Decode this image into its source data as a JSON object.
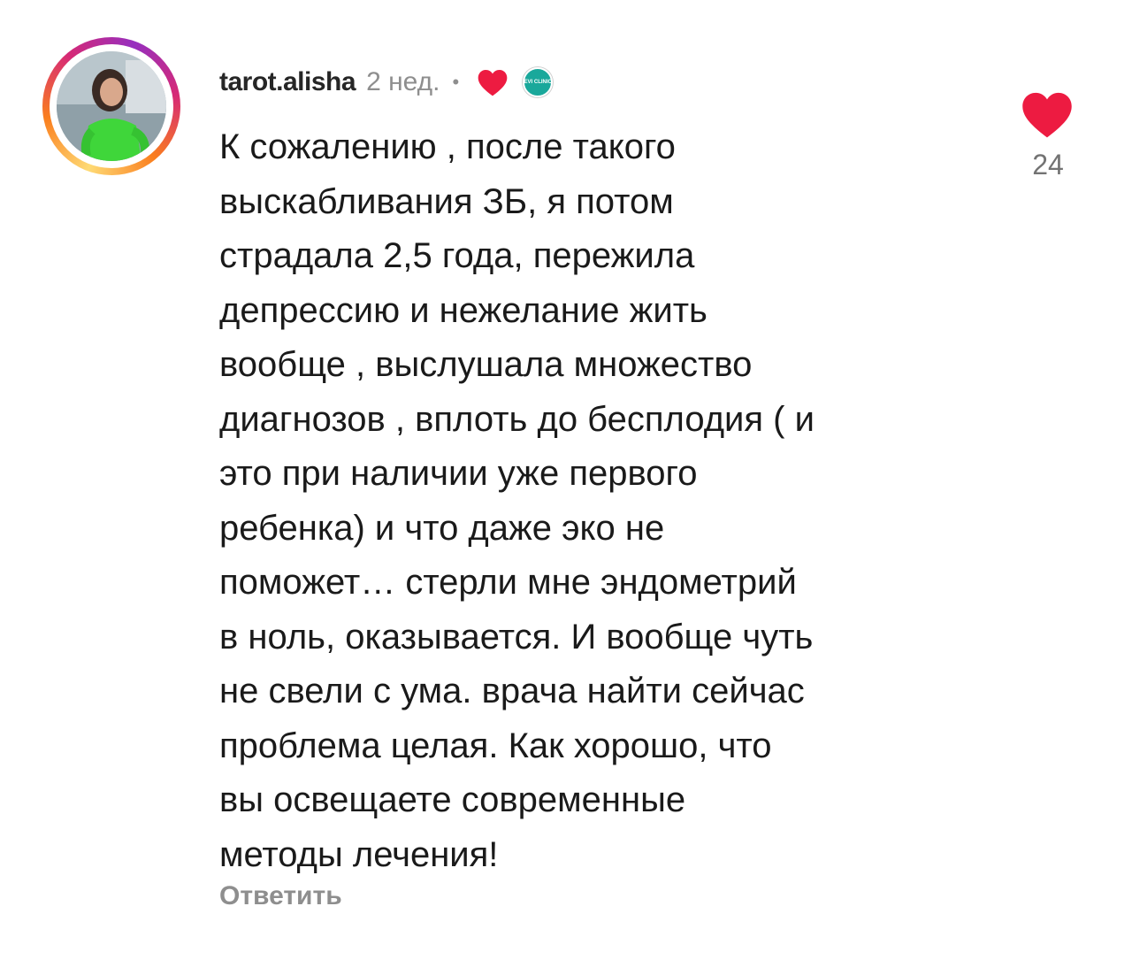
{
  "comment": {
    "username": "tarot.alisha",
    "time": "2 нед.",
    "separator": "•",
    "creator_liked_icon": "heart-icon",
    "clinic_badge_text": "EVI CLINIC",
    "text": "К сожалению , после такого\nвыскабливания ЗБ, я потом\nстрадала 2,5 года, пережила\nдепрессию и нежелание жить\nвообще , выслушала множество\nдиагнозов , вплоть до бесплодия ( и\nэто при наличии уже первого\nребенка) и что даже эко не\nпоможет… стерли мне эндометрий\nв ноль, оказывается. И вообще чуть\nне свели с ума. врача найти сейчас\nпроблема целая. Как хорошо, что\nвы освещаете современные\nметоды лечения!",
    "reply_label": "Ответить",
    "like_count": "24"
  },
  "colors": {
    "heart": "#ed1b41",
    "username": "#262626",
    "muted": "#8e8e8e",
    "clinic": "#1aa89b"
  }
}
